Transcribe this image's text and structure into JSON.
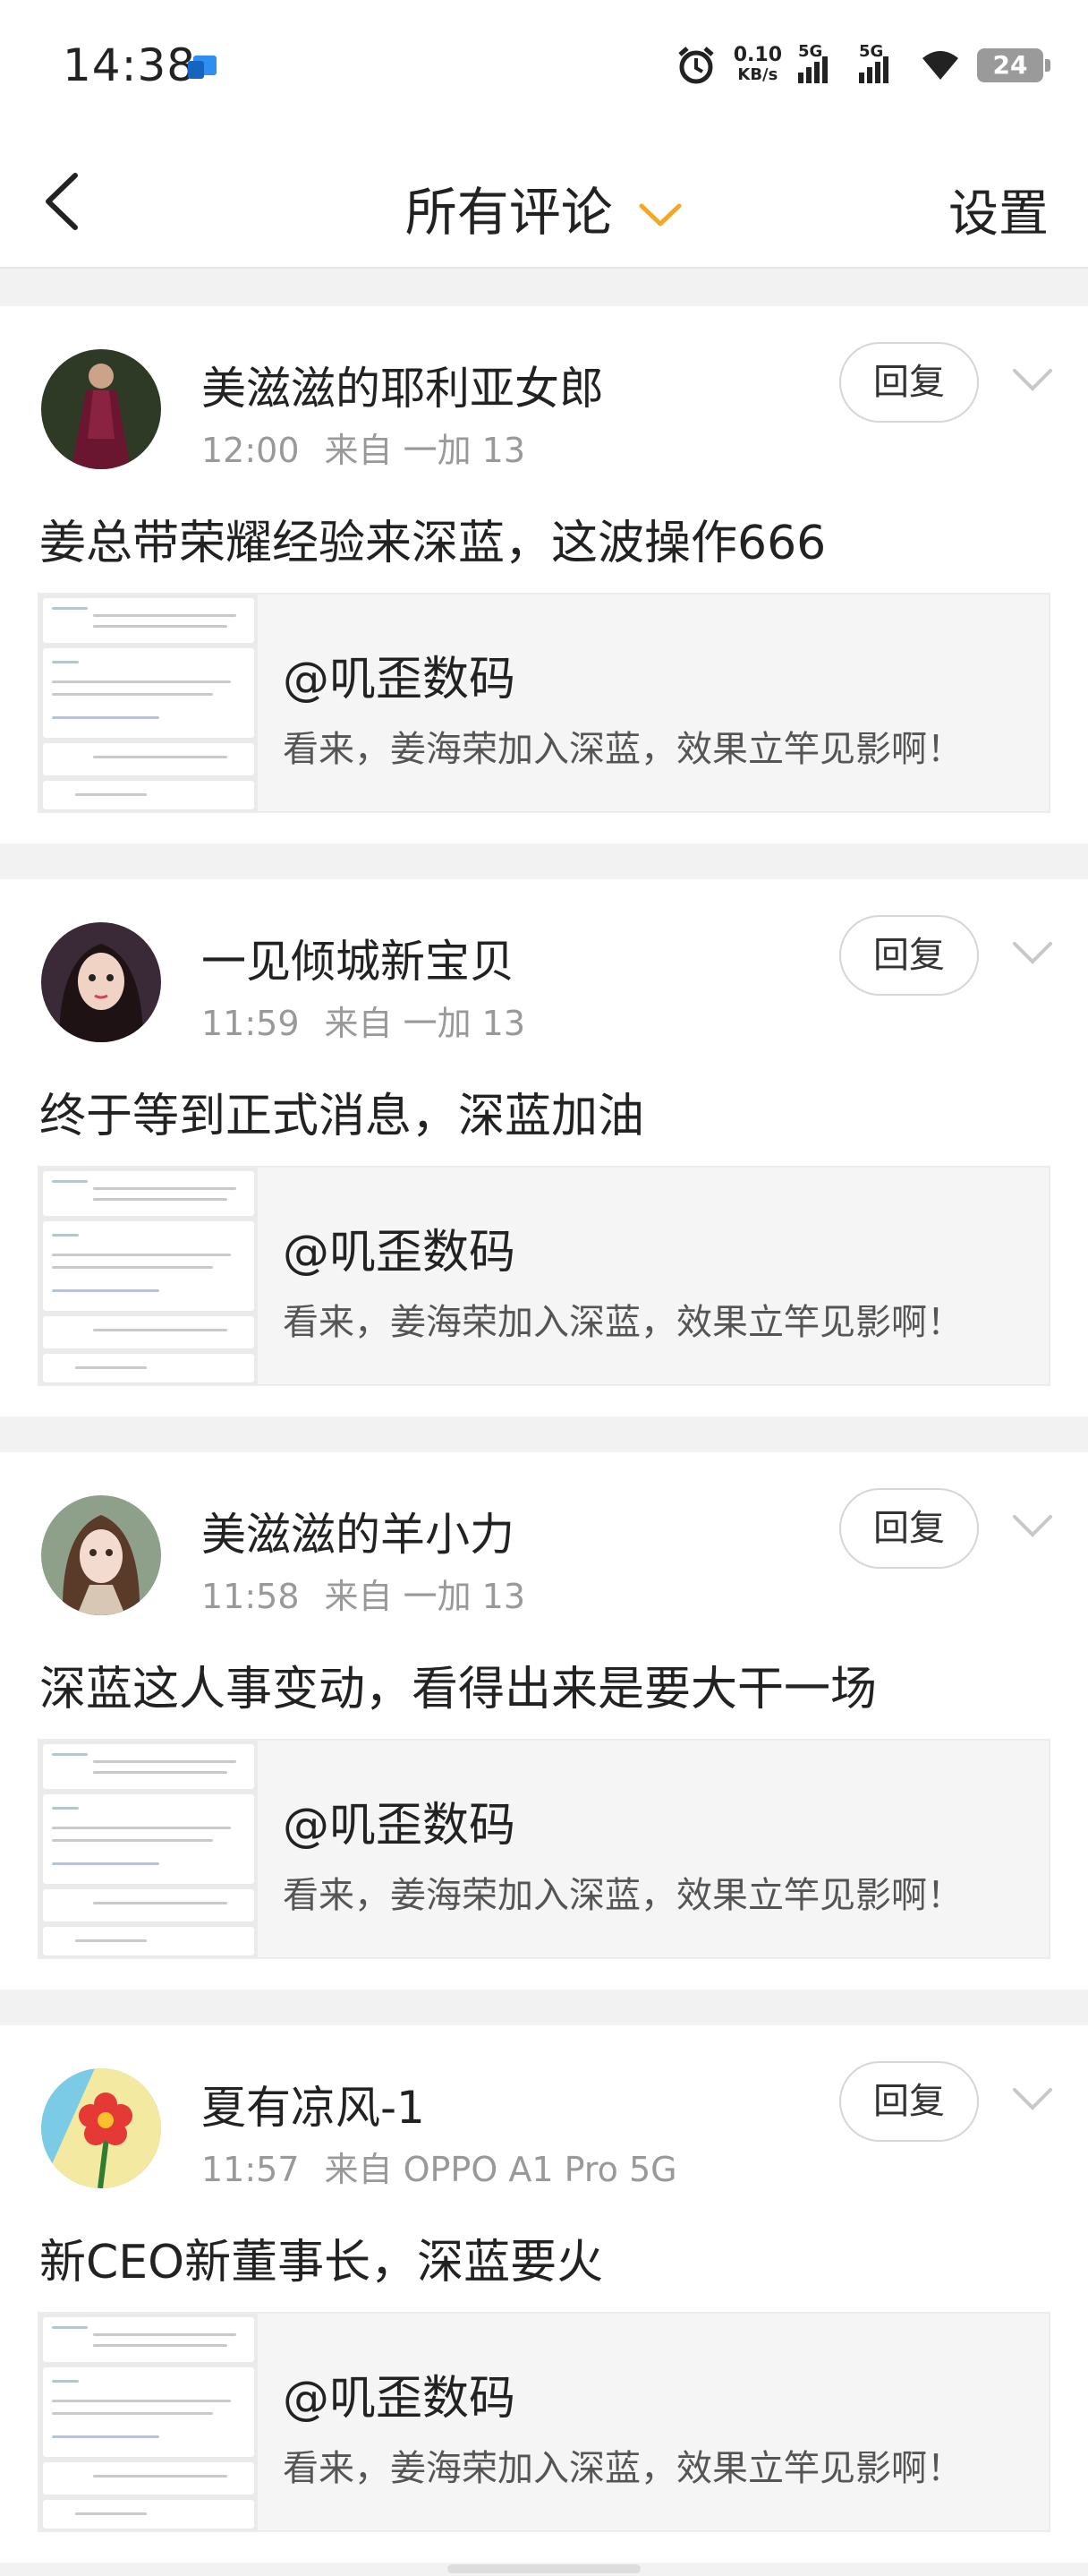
{
  "status_bar": {
    "time": "14:38",
    "net_speed_value": "0.10",
    "net_speed_unit": "KB/s",
    "signal1_label": "5G",
    "signal2_label": "5G",
    "battery": "24"
  },
  "nav": {
    "back_icon": "chevron-left-icon",
    "title": "所有评论",
    "title_dropdown_icon": "chevron-down-icon",
    "accent_color": "#f5a623",
    "settings_label": "设置"
  },
  "comments": [
    {
      "username": "美滋滋的耶利亚女郎",
      "time": "12:00",
      "source": "来自 一加 13",
      "reply_label": "回复",
      "text": "姜总带荣耀经验来深蓝，这波操作666",
      "quote_author": "@叽歪数码",
      "quote_text": "看来，姜海荣加入深蓝，效果立竿见影啊！"
    },
    {
      "username": "一见倾城新宝贝",
      "time": "11:59",
      "source": "来自 一加 13",
      "reply_label": "回复",
      "text": "终于等到正式消息，深蓝加油",
      "quote_author": "@叽歪数码",
      "quote_text": "看来，姜海荣加入深蓝，效果立竿见影啊！"
    },
    {
      "username": "美滋滋的羊小力",
      "time": "11:58",
      "source": "来自 一加 13",
      "reply_label": "回复",
      "text": "深蓝这人事变动，看得出来是要大干一场",
      "quote_author": "@叽歪数码",
      "quote_text": "看来，姜海荣加入深蓝，效果立竿见影啊！"
    },
    {
      "username": "夏有凉风-1",
      "time": "11:57",
      "source": "来自 OPPO A1 Pro 5G",
      "reply_label": "回复",
      "text": "新CEO新董事长，深蓝要火",
      "quote_author": "@叽歪数码",
      "quote_text": "看来，姜海荣加入深蓝，效果立竿见影啊！"
    }
  ]
}
